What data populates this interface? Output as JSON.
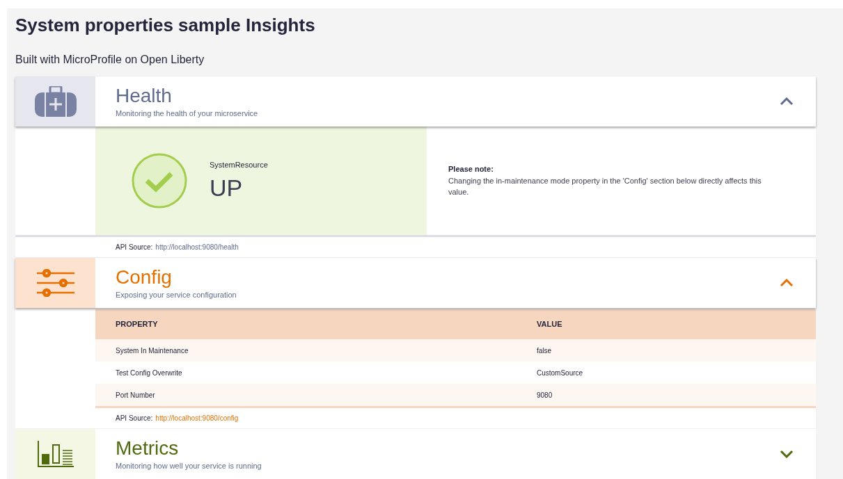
{
  "title": "System properties sample Insights",
  "subtitle": "Built with MicroProfile on Open Liberty",
  "sections": [
    {
      "kind": "health",
      "title": "Health",
      "description": "Monitoring the health of your microservice",
      "expanded": true,
      "health": {
        "status_ok": true,
        "name": "SystemResource",
        "status": "UP",
        "note_title": "Please note:",
        "note": "Changing the in-maintenance mode property in the 'Config' section below directly affects this value."
      },
      "api_label": "API Source:",
      "api_url": "http://localhost:9080/health"
    },
    {
      "kind": "config",
      "title": "Config",
      "description": "Exposing your service configuration",
      "expanded": true,
      "table": {
        "columns": [
          "PROPERTY",
          "VALUE"
        ],
        "rows": [
          [
            "System In Maintenance",
            "false"
          ],
          [
            "Test Config Overwrite",
            "CustomSource"
          ],
          [
            "Port Number",
            "9080"
          ]
        ]
      },
      "api_label": "API Source:",
      "api_url": "http://localhost:9080/config"
    },
    {
      "kind": "metrics",
      "title": "Metrics",
      "description": "Monitoring how well your service is running",
      "expanded": false
    }
  ]
}
